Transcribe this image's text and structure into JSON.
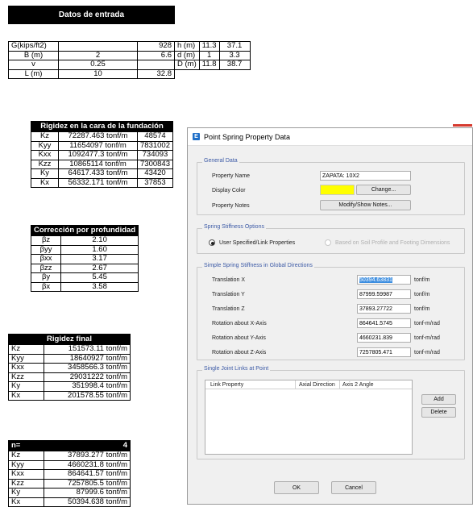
{
  "input_section": {
    "title": "Datos de entrada",
    "rows": [
      {
        "label": "G(kips/ft2)",
        "v1": "",
        "v2": "928",
        "label2": "h (m)",
        "v3": "11.3",
        "v4": "37.1"
      },
      {
        "label": "B (m)",
        "v1": "2",
        "v2": "6.6",
        "label2": "d (m)",
        "v3": "1",
        "v4": "3.3"
      },
      {
        "label": "v",
        "v1": "0.25",
        "v2": "",
        "label2": "D (m)",
        "v3": "11.8",
        "v4": "38.7"
      },
      {
        "label": "L (m)",
        "v1": "10",
        "v2": "32.8"
      }
    ]
  },
  "stiffness_table": {
    "title": "Rigidez en la cara de la fundación",
    "rows": [
      {
        "k": "Kz",
        "val": "72287.463 tonf/m",
        "alt": "48574"
      },
      {
        "k": "Kyy",
        "val": "11654097 tonf/m",
        "alt": "7831002"
      },
      {
        "k": "Kxx",
        "val": "1092477.3 tonf/m",
        "alt": "734093"
      },
      {
        "k": "Kzz",
        "val": "10865114 tonf/m",
        "alt": "7300843"
      },
      {
        "k": "Ky",
        "val": "64617.433 tonf/m",
        "alt": "43420"
      },
      {
        "k": "Kx",
        "val": "56332.171 tonf/m",
        "alt": "37853"
      }
    ]
  },
  "depth_table": {
    "title": "Corrección por profundidad",
    "rows": [
      {
        "k": "βz",
        "val": "2.10"
      },
      {
        "k": "βyy",
        "val": "1.60"
      },
      {
        "k": "βxx",
        "val": "3.17"
      },
      {
        "k": "βzz",
        "val": "2.67"
      },
      {
        "k": "βy",
        "val": "5.45"
      },
      {
        "k": "βx",
        "val": "3.58"
      }
    ]
  },
  "final_table": {
    "title": "Rigidez final",
    "rows": [
      {
        "k": "Kz",
        "val": "151573.11 tonf/m"
      },
      {
        "k": "Kyy",
        "val": "18640927 tonf/m"
      },
      {
        "k": "Kxx",
        "val": "3458566.3 tonf/m"
      },
      {
        "k": "Kzz",
        "val": "29031222 tonf/m"
      },
      {
        "k": "Ky",
        "val": "351998.4 tonf/m"
      },
      {
        "k": "Kx",
        "val": "201578.55 tonf/m"
      }
    ]
  },
  "n_table": {
    "title": "n=",
    "n_value": "4",
    "rows": [
      {
        "k": "Kz",
        "val": "37893.277 tonf/m"
      },
      {
        "k": "Kyy",
        "val": "4660231.8 tonf/m"
      },
      {
        "k": "Kxx",
        "val": "864641.57 tonf/m"
      },
      {
        "k": "Kzz",
        "val": "7257805.5 tonf/m"
      },
      {
        "k": "Ky",
        "val": "87999.6 tonf/m"
      },
      {
        "k": "Kx",
        "val": "50394.638 tonf/m"
      }
    ]
  },
  "dialog": {
    "title": "Point Spring Property Data",
    "icon": "etabs-app-icon",
    "general": {
      "legend": "General Data",
      "property_name_label": "Property Name",
      "property_name_value": "ZAPATA: 10X2",
      "display_color_label": "Display Color",
      "display_color": "#ffff00",
      "change_button": "Change...",
      "property_notes_label": "Property Notes",
      "notes_button": "Modify/Show Notes..."
    },
    "options": {
      "legend": "Spring Stiffness Options",
      "option1": "User Specified/Link Properties",
      "option2": "Based on Soil Profile and Footing Dimensions"
    },
    "simple": {
      "legend": "Simple Spring Stiffness in Global Directions",
      "rows": [
        {
          "label": "Translation  X",
          "value": "50394.63831",
          "unit": "tonf/m"
        },
        {
          "label": "Translation  Y",
          "value": "87999.59987",
          "unit": "tonf/m"
        },
        {
          "label": "Translation  Z",
          "value": "37893.27722",
          "unit": "tonf/m"
        },
        {
          "label": "Rotation about  X-Axis",
          "value": "864641.5745",
          "unit": "tonf-m/rad"
        },
        {
          "label": "Rotation about  Y-Axis",
          "value": "4660231.839",
          "unit": "tonf-m/rad"
        },
        {
          "label": "Rotation about  Z-Axis",
          "value": "7257805.471",
          "unit": "tonf-m/rad"
        }
      ]
    },
    "links": {
      "legend": "Single Joint Links at Point",
      "columns": [
        "Link Property",
        "Axial Direction",
        "Axis 2 Angle"
      ],
      "add_button": "Add",
      "delete_button": "Delete"
    },
    "ok_button": "OK",
    "cancel_button": "Cancel"
  }
}
